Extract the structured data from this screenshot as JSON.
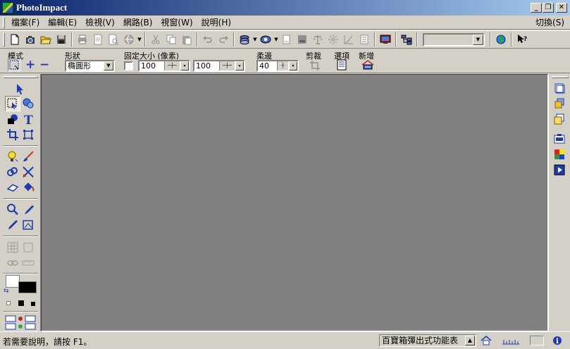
{
  "window": {
    "title": "PhotoImpact",
    "minimize": "_",
    "restore": "❐",
    "close": "✕"
  },
  "menu": {
    "items": [
      "檔案(F)",
      "編輯(E)",
      "檢視(V)",
      "網路(B)",
      "視窗(W)",
      "說明(H)"
    ],
    "switch_label": "切換(S)"
  },
  "attributes": {
    "mode_label": "模式",
    "shape_label": "形狀",
    "shape_value": "橢圓形",
    "fixed_size_label": "固定大小 (像素)",
    "width_value": "100",
    "height_value": "100",
    "soft_edge_label": "柔邊",
    "soft_edge_value": "40",
    "crop_label": "剪裁",
    "options_label": "選項",
    "add_label": "新增",
    "mode_add": "+",
    "mode_subtract": "−"
  },
  "status": {
    "message": "若需要說明，請按 F1。",
    "panel_dropdown": "百寶箱彈出式功能表"
  },
  "colors": {
    "titlebar_start": "#0a246a",
    "titlebar_end": "#a6caf0",
    "chrome": "#d4d0c8",
    "workspace": "#808080",
    "foreground_color": "#000000",
    "background_color": "#ffffff"
  }
}
